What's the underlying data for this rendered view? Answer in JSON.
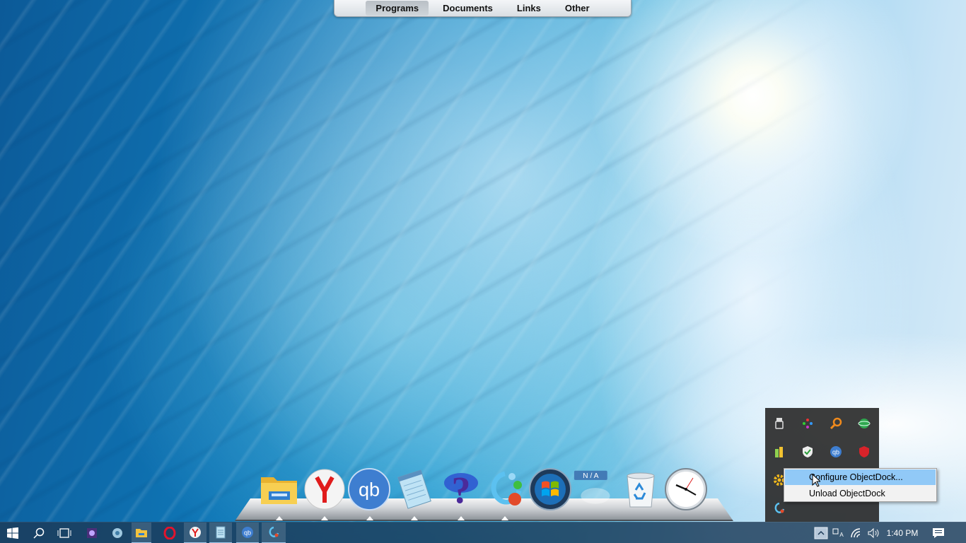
{
  "desktop": {
    "wallpaper": "ocean wave with sun"
  },
  "top_menu": {
    "tabs": [
      {
        "label": "Programs",
        "active": true
      },
      {
        "label": "Documents",
        "active": false
      },
      {
        "label": "Links",
        "active": false
      },
      {
        "label": "Other",
        "active": false
      }
    ]
  },
  "dock": {
    "items": [
      {
        "name": "file-explorer",
        "icon": "folder-icon",
        "running": true
      },
      {
        "name": "yandex-browser",
        "icon": "yandex-y-icon",
        "running": true
      },
      {
        "name": "qbittorrent",
        "icon": "qb-icon",
        "label": "qb",
        "running": true
      },
      {
        "name": "notepad",
        "icon": "notepad-icon",
        "running": true
      },
      {
        "name": "help",
        "icon": "question-mark-icon",
        "label": "?",
        "running": true
      },
      {
        "name": "objectdock",
        "icon": "objectdock-icon",
        "running": true
      },
      {
        "name": "windows-start",
        "icon": "windows-orb-icon",
        "running": false
      },
      {
        "name": "weather",
        "icon": "weather-widget-icon",
        "label": "N / A",
        "running": false
      },
      {
        "name": "recycle-bin",
        "icon": "recycle-bin-icon",
        "running": false
      },
      {
        "name": "clock",
        "icon": "clock-icon",
        "running": false
      }
    ]
  },
  "tray_overflow": {
    "icons": [
      "usb-eject-icon",
      "color-dots-icon",
      "search-tool-icon",
      "network-globe-icon",
      "battery-icon",
      "shield-check-icon",
      "qbittorrent-tray-icon",
      "antivirus-shield-icon",
      "gear-icon",
      "objectdock-tray-icon"
    ]
  },
  "context_menu": {
    "items": [
      {
        "label": "Configure ObjectDock...",
        "hovered": true
      },
      {
        "label": "Unload ObjectDock",
        "hovered": false
      }
    ]
  },
  "taskbar": {
    "clock": "1:40 PM",
    "pinned": [
      "start-icon",
      "search-icon",
      "task-view-icon",
      "app-icon-1",
      "app-icon-2",
      "file-explorer-icon",
      "opera-icon",
      "yandex-icon",
      "notepad-icon",
      "qbittorrent-icon",
      "objectdock-icon"
    ],
    "tray": [
      "show-hidden-icons-chevron",
      "keyboard-language-icon",
      "wifi-icon",
      "volume-icon",
      "action-center-icon"
    ]
  },
  "colors": {
    "taskbar": "#1c3a58",
    "menu_hover": "#91c9f7",
    "panel": "#2b2b2b"
  }
}
